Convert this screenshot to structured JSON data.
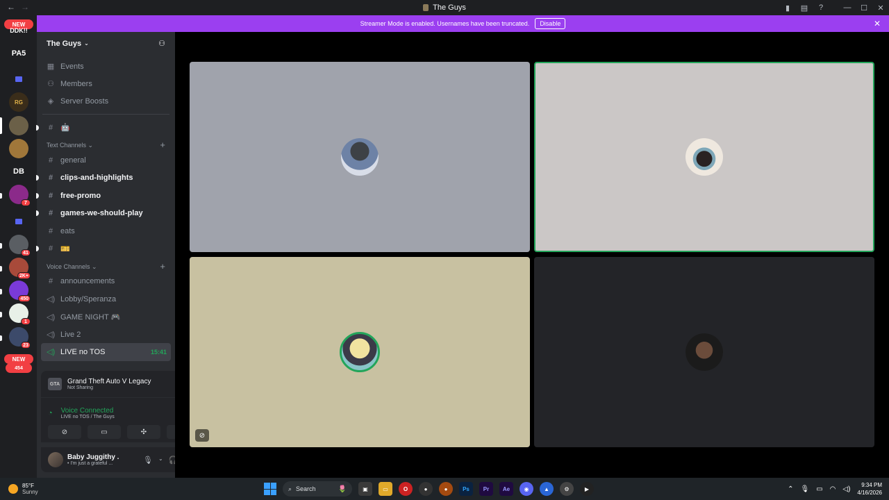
{
  "window": {
    "title": "The Guys"
  },
  "banner": {
    "message": "Streamer Mode is enabled. Usernames have been truncated.",
    "disable_label": "Disable"
  },
  "rail": {
    "new_label_top": "NEW",
    "partial_name": "DDK!!",
    "pa5": "PA5",
    "db": "DB",
    "badges": [
      "7",
      "41",
      "2K+",
      "450",
      "1",
      "23"
    ],
    "new_label_bottom": "NEW",
    "new_count_bottom": "454"
  },
  "server": {
    "name": "The Guys",
    "nav": [
      {
        "label": "Events",
        "icon": "calendar-icon"
      },
      {
        "label": "Members",
        "icon": "members-icon"
      },
      {
        "label": "Server Boosts",
        "icon": "boost-icon"
      }
    ],
    "top_channel_emoji": "🤖",
    "text_category": "Text Channels",
    "text_channels": [
      {
        "label": "general",
        "unread": false
      },
      {
        "label": "clips-and-highlights",
        "unread": true
      },
      {
        "label": "free-promo",
        "unread": true
      },
      {
        "label": "games-we-should-play",
        "unread": true
      },
      {
        "label": "eats",
        "unread": false
      },
      {
        "label": "🎫",
        "unread": false
      }
    ],
    "voice_category": "Voice Channels",
    "voice_channels": [
      {
        "label": "announcements",
        "icon": "hash-icon"
      },
      {
        "label": "Lobby/Speranza",
        "icon": "speaker-icon"
      },
      {
        "label": "GAME NIGHT 🎮",
        "icon": "speaker-icon"
      },
      {
        "label": "Live 2",
        "icon": "speaker-icon"
      }
    ],
    "active_voice": {
      "label": "LIVE no TOS",
      "time": "15:41"
    }
  },
  "game": {
    "title": "Grand Theft Auto V Legacy",
    "status": "Not Sharing",
    "icon_text": "GTA"
  },
  "voice": {
    "status": "Voice Connected",
    "location": "LIVE no TOS / The Guys"
  },
  "user": {
    "name": "Baby Juggithy .",
    "status": "• I'm just a grateful ..."
  },
  "taskbar": {
    "weather_temp": "85°F",
    "weather_cond": "Sunny",
    "search_label": "Search",
    "time": "9:34 PM",
    "date": "4/16/2026",
    "apps": [
      {
        "label": "Ps",
        "color": "#0a2240"
      },
      {
        "label": "Pr",
        "color": "#1f0a40"
      },
      {
        "label": "Ae",
        "color": "#1f0a40"
      }
    ]
  }
}
